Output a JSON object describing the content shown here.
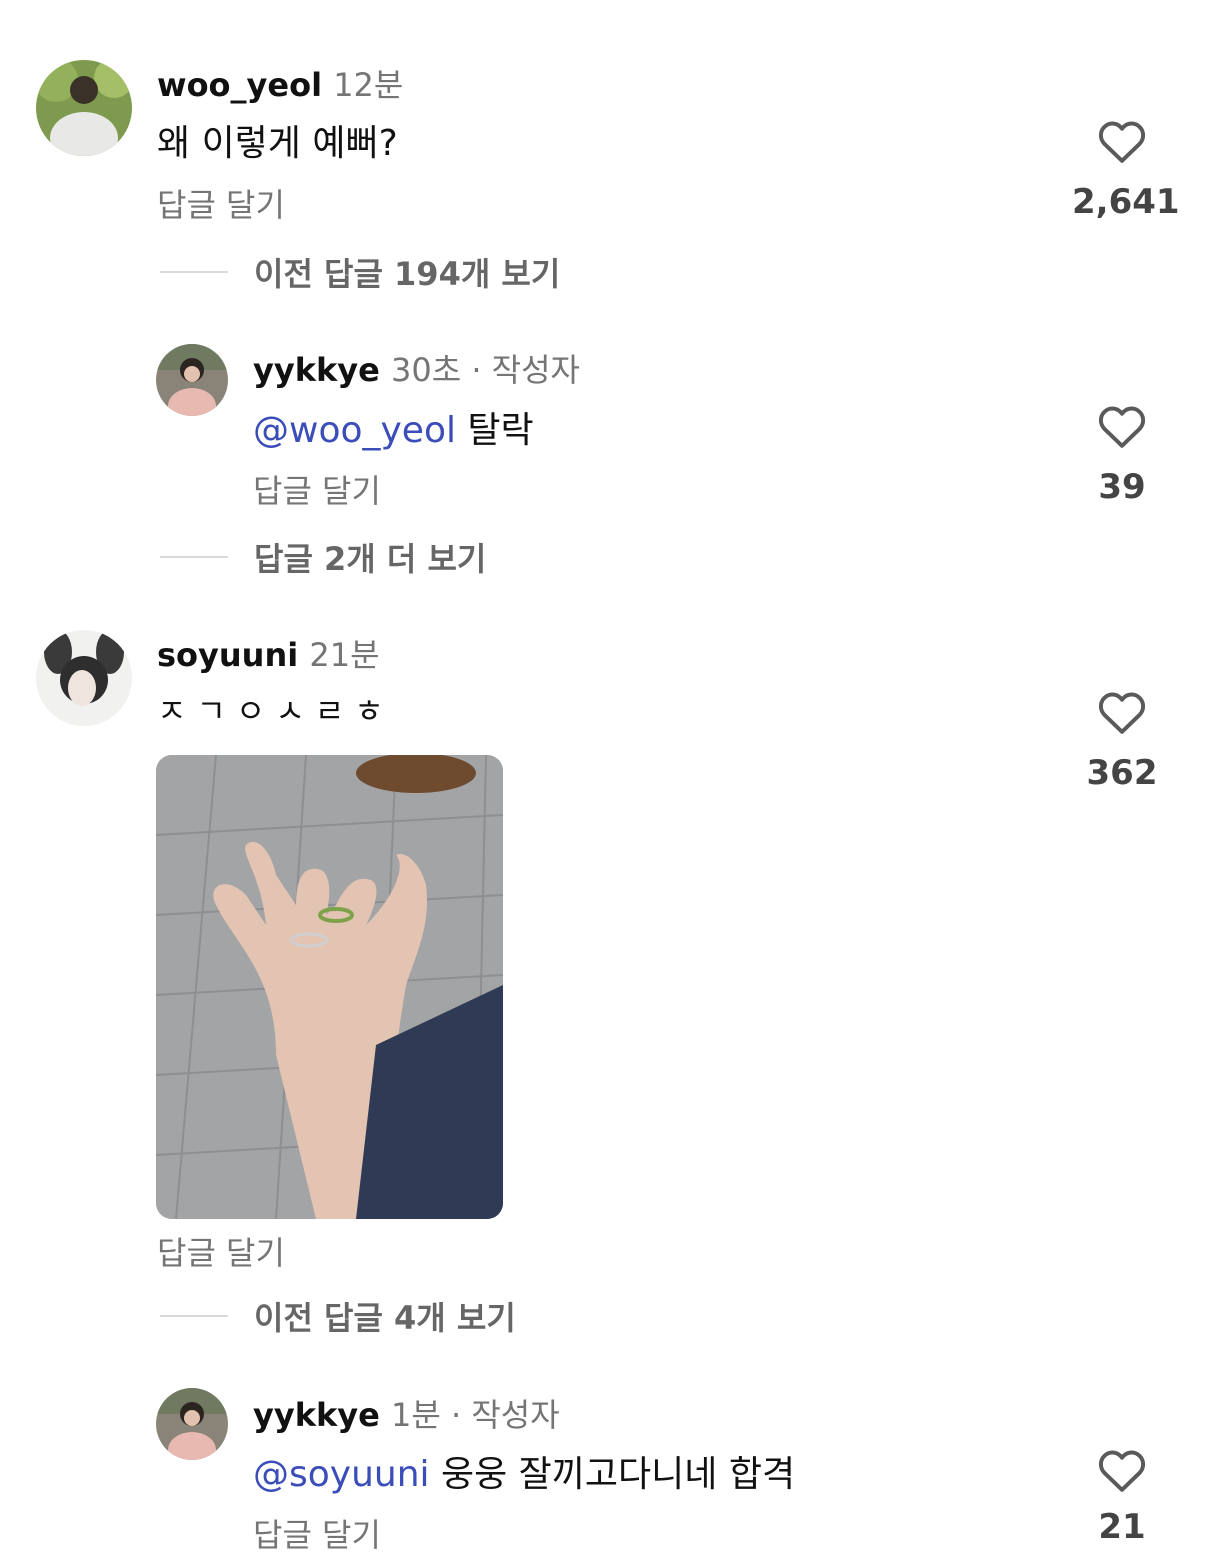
{
  "comments": [
    {
      "username": "woo_yeol",
      "time": "12분",
      "author_tag": "",
      "mention": "",
      "text": "왜 이렇게 예뻐?",
      "reply_label": "답글 달기",
      "likes": "2,641",
      "thread_label": "이전 답글 194개 보기"
    },
    {
      "username": "yykkye",
      "time": "30초",
      "author_tag": " · 작성자",
      "mention": "@woo_yeol",
      "text": " 탈락",
      "reply_label": "답글 달기",
      "likes": "39",
      "thread_label": "답글 2개 더 보기"
    },
    {
      "username": "soyuuni",
      "time": "21분",
      "author_tag": "",
      "mention": "",
      "text": "ㅈㄱㅇㅅㄹㅎ",
      "reply_label": "답글 달기",
      "likes": "362",
      "thread_label": "이전 답글 4개 보기"
    },
    {
      "username": "yykkye",
      "time": "1분",
      "author_tag": " · 작성자",
      "mention": "@soyuuni",
      "text": " 웅웅 잘끼고다니네 합격",
      "reply_label": "답글 달기",
      "likes": "21",
      "thread_label": ""
    }
  ],
  "icons": {
    "like": "heart-outline-icon"
  },
  "colors": {
    "mention": "#3b4db8",
    "secondary_text": "#757575",
    "thread_line": "#d9d9d9"
  }
}
